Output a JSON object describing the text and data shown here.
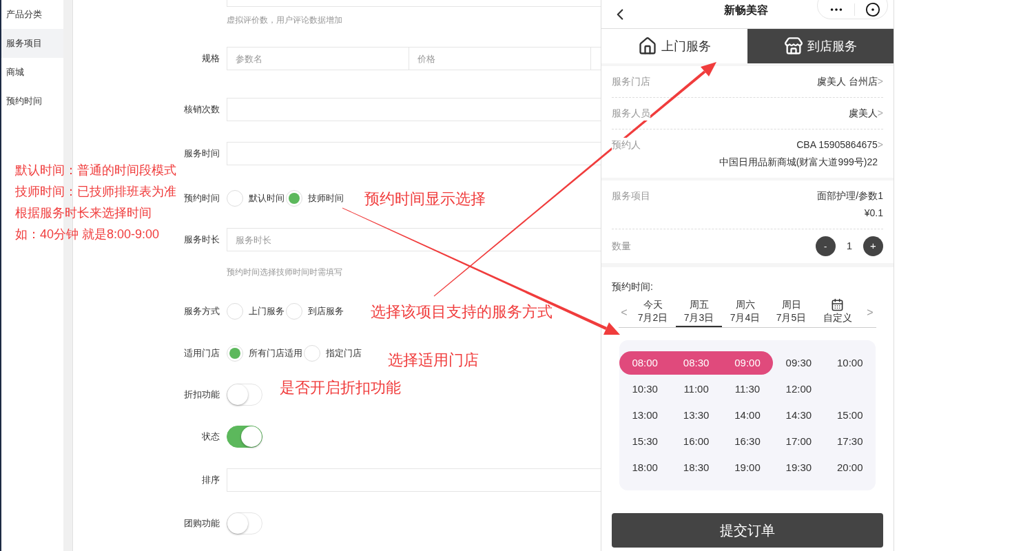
{
  "sidebar": {
    "items": [
      {
        "label": "产品分类",
        "selected": false
      },
      {
        "label": "服务项目",
        "selected": true
      },
      {
        "label": "商城",
        "selected": false
      },
      {
        "label": "预约时间",
        "selected": false
      }
    ]
  },
  "form": {
    "fields": [
      {
        "kind": "input_cut"
      },
      {
        "kind": "hint",
        "text": "虚拟评价数，用户评论数据增加"
      },
      {
        "kind": "multi_input",
        "label": "规格",
        "placeholders": [
          "参数名",
          "价格"
        ]
      },
      {
        "kind": "input",
        "label": "核销次数"
      },
      {
        "kind": "input",
        "label": "服务时间"
      },
      {
        "kind": "radio",
        "label": "预约时间",
        "options": [
          {
            "label": "默认时间",
            "selected": false
          },
          {
            "label": "技师时间",
            "selected": true
          }
        ]
      },
      {
        "kind": "input",
        "label": "服务时长",
        "placeholder": "服务时长"
      },
      {
        "kind": "hint",
        "text": "预约时间选择技师时间时需填写"
      },
      {
        "kind": "radio",
        "label": "服务方式",
        "options": [
          {
            "label": "上门服务",
            "selected": false
          },
          {
            "label": "到店服务",
            "selected": false
          }
        ]
      },
      {
        "kind": "radio",
        "label": "适用门店",
        "options": [
          {
            "label": "所有门店适用",
            "selected": true
          },
          {
            "label": "指定门店",
            "selected": false
          }
        ]
      },
      {
        "kind": "toggle",
        "label": "折扣功能",
        "on": false
      },
      {
        "kind": "toggle",
        "label": "状态",
        "on": true
      },
      {
        "kind": "input",
        "label": "排序"
      },
      {
        "kind": "toggle",
        "label": "团购功能",
        "on": false
      }
    ]
  },
  "phone": {
    "title": "新畅美容",
    "service_tabs": [
      {
        "label": "上门服务",
        "selected": false
      },
      {
        "label": "到店服务",
        "selected": true
      }
    ],
    "info_groups": [
      [
        {
          "label": "服务门店",
          "values": [
            "虞美人 台州店"
          ],
          "chevron": ">"
        },
        {
          "label": "服务人员",
          "values": [
            "虞美人"
          ],
          "chevron": ">"
        },
        {
          "label": "预约人",
          "values": [
            "CBA 15905864675",
            "中国日用品新商城(财富大道999号)22"
          ],
          "chevron": ">"
        }
      ],
      [
        {
          "label": "服务项目",
          "values": [
            "面部护理/参数1",
            "¥0.1"
          ]
        }
      ]
    ],
    "quantity": {
      "label": "数量",
      "minus": "-",
      "value": "1",
      "plus": "+"
    },
    "booking": {
      "label": "预约时间:",
      "prev": "<",
      "next": ">",
      "dates": [
        {
          "kind": "date",
          "top": "今天",
          "bottom": "7月2日",
          "selected": false
        },
        {
          "kind": "date",
          "top": "周五",
          "bottom": "7月3日",
          "selected": true
        },
        {
          "kind": "date",
          "top": "周六",
          "bottom": "7月4日",
          "selected": false
        },
        {
          "kind": "date",
          "top": "周日",
          "bottom": "7月5日",
          "selected": false
        },
        {
          "kind": "calendar",
          "bottom": "自定义",
          "selected": false
        }
      ],
      "slot_rows": [
        [
          {
            "time": "08:00",
            "selected": true
          },
          {
            "time": "08:30",
            "selected": true
          },
          {
            "time": "09:00",
            "selected": true
          },
          {
            "time": "09:30",
            "selected": false
          },
          {
            "time": "10:00",
            "selected": false
          }
        ],
        [
          {
            "time": "10:30",
            "selected": false
          },
          {
            "time": "11:00",
            "selected": false
          },
          {
            "time": "11:30",
            "selected": false
          },
          {
            "time": "12:00",
            "selected": false
          }
        ],
        [
          {
            "time": "13:00",
            "selected": false
          },
          {
            "time": "13:30",
            "selected": false
          },
          {
            "time": "14:00",
            "selected": false
          },
          {
            "time": "14:30",
            "selected": false
          },
          {
            "time": "15:00",
            "selected": false
          }
        ],
        [
          {
            "time": "15:30",
            "selected": false
          },
          {
            "time": "16:00",
            "selected": false
          },
          {
            "time": "16:30",
            "selected": false
          },
          {
            "time": "17:00",
            "selected": false
          },
          {
            "time": "17:30",
            "selected": false
          }
        ],
        [
          {
            "time": "18:00",
            "selected": false
          },
          {
            "time": "18:30",
            "selected": false
          },
          {
            "time": "19:00",
            "selected": false
          },
          {
            "time": "19:30",
            "selected": false
          },
          {
            "time": "20:00",
            "selected": false
          }
        ]
      ]
    },
    "submit": "提交订单"
  },
  "annotations": {
    "note_lines": [
      "默认时间：普通的时间段模式",
      "技师时间：已技师排班表为准",
      "根据服务时长来选择时间",
      "如：40分钟 就是8:00-9:00"
    ],
    "callouts": [
      "预约时间显示选择",
      "选择该项目支持的服务方式",
      "选择适用门店",
      "是否开启折扣功能"
    ]
  }
}
